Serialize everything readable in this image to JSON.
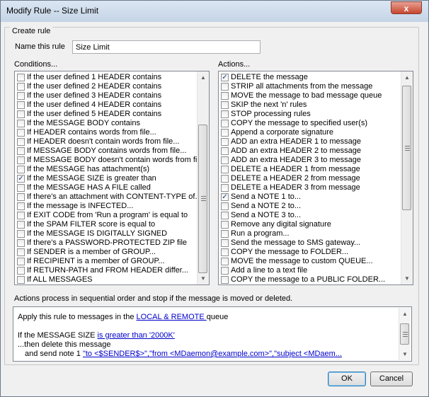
{
  "window": {
    "title": "Modify Rule -- Size Limit",
    "close_glyph": "x"
  },
  "create_rule": {
    "group_label": "Create rule",
    "name_label": "Name this rule",
    "name_value": "Size Limit"
  },
  "conditions": {
    "label": "Conditions...",
    "items": [
      {
        "text": "If the user defined 1 HEADER contains",
        "checked": false
      },
      {
        "text": "If the user defined 2 HEADER contains",
        "checked": false
      },
      {
        "text": "If the user defined 3 HEADER contains",
        "checked": false
      },
      {
        "text": "If the user defined 4 HEADER contains",
        "checked": false
      },
      {
        "text": "If the user defined 5 HEADER contains",
        "checked": false
      },
      {
        "text": "If the MESSAGE BODY contains",
        "checked": false
      },
      {
        "text": "If HEADER contains words from file...",
        "checked": false
      },
      {
        "text": "If HEADER doesn't contain words from file...",
        "checked": false
      },
      {
        "text": "If MESSAGE BODY contains words from file...",
        "checked": false
      },
      {
        "text": "If MESSAGE BODY doesn't contain words from file",
        "checked": false
      },
      {
        "text": "If the MESSAGE has attachment(s)",
        "checked": false
      },
      {
        "text": "If the MESSAGE SIZE is greater than",
        "checked": true
      },
      {
        "text": "If the MESSAGE HAS A FILE called",
        "checked": false
      },
      {
        "text": "If there's an attachment with CONTENT-TYPE of...",
        "checked": false
      },
      {
        "text": "If the message is INFECTED...",
        "checked": false
      },
      {
        "text": "If EXIT CODE from 'Run a program' is equal to",
        "checked": false
      },
      {
        "text": "If the SPAM FILTER score is equal to",
        "checked": false
      },
      {
        "text": "If the MESSAGE IS DIGITALLY SIGNED",
        "checked": false
      },
      {
        "text": "If there's a PASSWORD-PROTECTED ZIP file",
        "checked": false
      },
      {
        "text": "If SENDER is a member of GROUP...",
        "checked": false
      },
      {
        "text": "If RECIPIENT is a member of GROUP...",
        "checked": false
      },
      {
        "text": "If RETURN-PATH and FROM HEADER differ...",
        "checked": false
      },
      {
        "text": "If ALL MESSAGES",
        "checked": false
      }
    ]
  },
  "actions": {
    "label": "Actions...",
    "items": [
      {
        "text": "DELETE the message",
        "checked": true
      },
      {
        "text": "STRIP all attachments from the message",
        "checked": false
      },
      {
        "text": "MOVE the message to bad message queue",
        "checked": false
      },
      {
        "text": "SKIP the next 'n' rules",
        "checked": false
      },
      {
        "text": "STOP processing rules",
        "checked": false
      },
      {
        "text": "COPY the message to specified user(s)",
        "checked": false
      },
      {
        "text": "Append a corporate signature",
        "checked": false
      },
      {
        "text": "ADD an extra HEADER 1 to message",
        "checked": false
      },
      {
        "text": "ADD an extra HEADER 2 to message",
        "checked": false
      },
      {
        "text": "ADD an extra HEADER 3 to message",
        "checked": false
      },
      {
        "text": "DELETE a HEADER 1 from message",
        "checked": false
      },
      {
        "text": "DELETE a HEADER 2 from message",
        "checked": false
      },
      {
        "text": "DELETE a HEADER 3 from message",
        "checked": false
      },
      {
        "text": "Send a NOTE 1 to...",
        "checked": true
      },
      {
        "text": "Send a NOTE 2 to...",
        "checked": false
      },
      {
        "text": "Send a NOTE 3 to...",
        "checked": false
      },
      {
        "text": "Remove any digital signature",
        "checked": false
      },
      {
        "text": "Run a program...",
        "checked": false
      },
      {
        "text": "Send the message to SMS gateway...",
        "checked": false
      },
      {
        "text": "COPY the message to FOLDER...",
        "checked": false
      },
      {
        "text": "MOVE the message to custom QUEUE...",
        "checked": false
      },
      {
        "text": "Add a line to a text file",
        "checked": false
      },
      {
        "text": "COPY the message to a PUBLIC FOLDER...",
        "checked": false
      }
    ]
  },
  "info_text": "Actions process in sequential order and stop if the message is moved or deleted.",
  "summary": {
    "line1_prefix": "Apply this rule to messages in the ",
    "line1_link": "LOCAL & REMOTE ",
    "line1_suffix": " queue",
    "line2_prefix": "If the MESSAGE SIZE ",
    "line2_link": "is greater than '2000K'",
    "line3": "...then delete this message",
    "line4_prefix": "and send note 1 ",
    "line4_link": "\"to <$SENDER$>\",\"from <MDaemon@example.com>\",\"subject <MDaem..."
  },
  "buttons": {
    "ok": "OK",
    "cancel": "Cancel"
  }
}
